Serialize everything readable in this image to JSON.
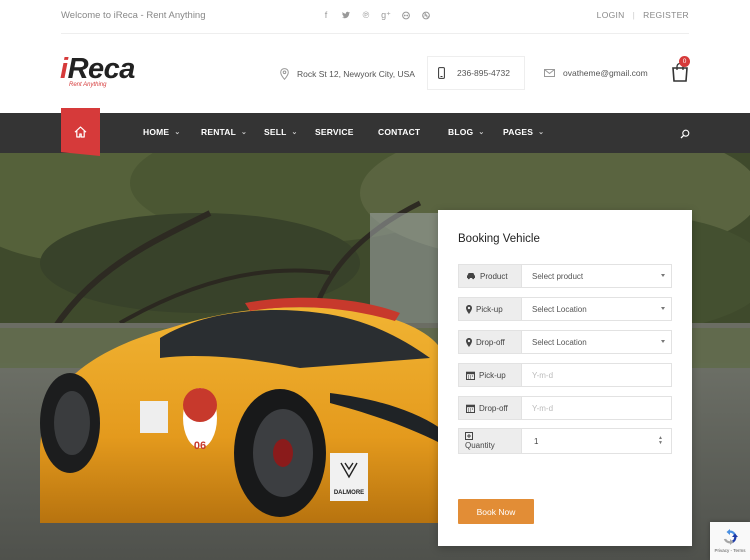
{
  "topbar": {
    "welcome": "Welcome to iReca - Rent Anything",
    "socials": [
      "facebook-icon",
      "twitter-icon",
      "pinterest-icon",
      "google-plus-icon",
      "flickr-icon",
      "dribbble-icon"
    ],
    "login": "LOGIN",
    "register": "REGISTER"
  },
  "header": {
    "logo_initial": "i",
    "logo_rest": "Reca",
    "logo_tagline": "Rent Anything",
    "address": "Rock St 12, Newyork City, USA",
    "phone": "236-895-4732",
    "email": "ovatheme@gmail.com",
    "cart_count": "0"
  },
  "nav": {
    "items": [
      {
        "label": "HOME",
        "dropdown": true
      },
      {
        "label": "RENTAL",
        "dropdown": true
      },
      {
        "label": "SELL",
        "dropdown": true
      },
      {
        "label": "SERVICE",
        "dropdown": false
      },
      {
        "label": "CONTACT",
        "dropdown": false
      },
      {
        "label": "BLOG",
        "dropdown": true
      },
      {
        "label": "PAGES",
        "dropdown": true
      }
    ]
  },
  "hero": {
    "car_sticker_1": "06",
    "car_sticker_2": "DALMORE"
  },
  "booking": {
    "title": "Booking Vehicle",
    "product_label": "Product",
    "product_value": "Select product",
    "pickup_label": "Pick-up",
    "pickup_value": "Select Location",
    "dropoff_label": "Drop-off",
    "dropoff_value": "Select Location",
    "pickup_date_label": "Pick-up",
    "pickup_date_placeholder": "Y-m-d",
    "dropoff_date_label": "Drop-off",
    "dropoff_date_placeholder": "Y-m-d",
    "quantity_label": "Quantity",
    "quantity_value": "1",
    "submit": "Book Now"
  },
  "recaptcha": {
    "text": "Privacy - Terms"
  },
  "colors": {
    "accent_red": "#d63a3a",
    "nav_bg": "#343434",
    "button_orange": "#e28d36"
  }
}
